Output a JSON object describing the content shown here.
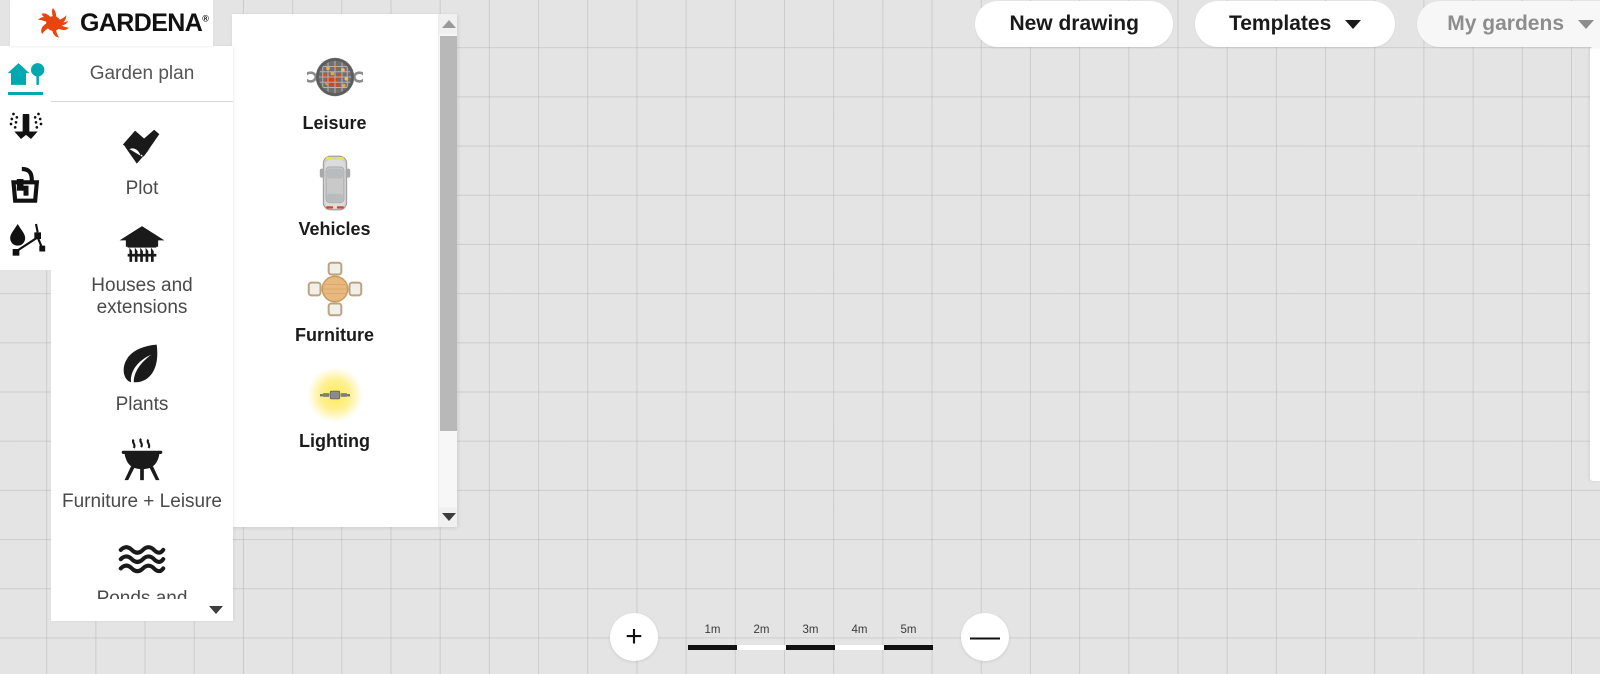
{
  "brand": {
    "name": "GARDENA",
    "trademark": "®",
    "logo_color": "#e8450f"
  },
  "topbar": {
    "buttons": [
      {
        "label": "New drawing",
        "icon": "",
        "disabled": false
      },
      {
        "label": "Templates",
        "icon": "chevron-down-icon",
        "disabled": false
      },
      {
        "label": "My gardens",
        "icon": "chevron-down-icon",
        "disabled": true
      }
    ]
  },
  "icon_rail": {
    "items": [
      {
        "name": "garden-plan",
        "icon": "house-tree-icon",
        "active": true
      },
      {
        "name": "sprinkler-irrigation",
        "icon": "sprinkler-icon",
        "active": false
      },
      {
        "name": "water-tap",
        "icon": "tap-bucket-icon",
        "active": false
      },
      {
        "name": "micro-drip",
        "icon": "drip-network-icon",
        "active": false
      }
    ]
  },
  "main_menu": {
    "tab_label": "Garden plan",
    "items": [
      {
        "label": "Plot",
        "icon": "plot-pen-icon"
      },
      {
        "label": "Houses and\nextensions",
        "icon": "house-fence-icon"
      },
      {
        "label": "Plants",
        "icon": "leaf-icon"
      },
      {
        "label": "Furniture + Leisure",
        "icon": "bbq-grill-icon"
      },
      {
        "label": "Ponds and",
        "icon": "water-waves-icon"
      }
    ],
    "scroll_down_icon": "triangle-down-icon"
  },
  "submenu": {
    "items": [
      {
        "label": "Leisure",
        "icon": "bbq-top-view-icon"
      },
      {
        "label": "Vehicles",
        "icon": "car-top-view-icon"
      },
      {
        "label": "Furniture",
        "icon": "table-chairs-top-view-icon"
      },
      {
        "label": "Lighting",
        "icon": "lamp-glow-icon"
      }
    ],
    "scrollbar": {
      "up_icon": "triangle-up-icon",
      "down_icon": "triangle-down-icon"
    }
  },
  "canvas": {
    "zoom_in_label": "+",
    "zoom_out_label": "—",
    "scale": {
      "unit_labels": [
        "1m",
        "2m",
        "3m",
        "4m",
        "5m"
      ],
      "segments": [
        "dark",
        "light",
        "dark",
        "light",
        "dark"
      ]
    }
  }
}
